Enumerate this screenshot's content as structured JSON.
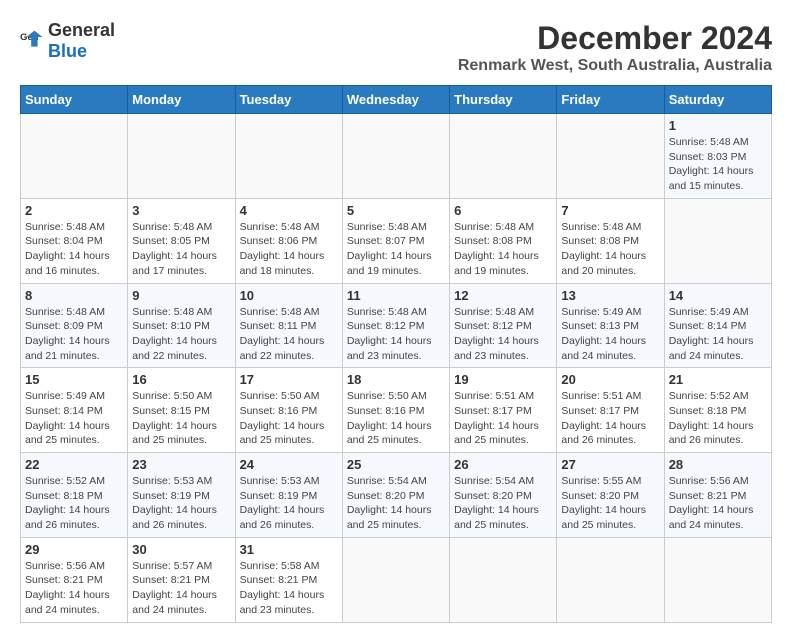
{
  "header": {
    "logo": {
      "general": "General",
      "blue": "Blue"
    },
    "title": "December 2024",
    "subtitle": "Renmark West, South Australia, Australia"
  },
  "calendar": {
    "days_of_week": [
      "Sunday",
      "Monday",
      "Tuesday",
      "Wednesday",
      "Thursday",
      "Friday",
      "Saturday"
    ],
    "weeks": [
      [
        {
          "day": "",
          "empty": true
        },
        {
          "day": "",
          "empty": true
        },
        {
          "day": "",
          "empty": true
        },
        {
          "day": "",
          "empty": true
        },
        {
          "day": "",
          "empty": true
        },
        {
          "day": "",
          "empty": true
        },
        {
          "day": "1",
          "sunrise": "Sunrise: 5:48 AM",
          "sunset": "Sunset: 8:03 PM",
          "daylight": "Daylight: 14 hours and 15 minutes."
        }
      ],
      [
        {
          "day": "2",
          "sunrise": "Sunrise: 5:48 AM",
          "sunset": "Sunset: 8:04 PM",
          "daylight": "Daylight: 14 hours and 16 minutes."
        },
        {
          "day": "3",
          "sunrise": "Sunrise: 5:48 AM",
          "sunset": "Sunset: 8:05 PM",
          "daylight": "Daylight: 14 hours and 17 minutes."
        },
        {
          "day": "4",
          "sunrise": "Sunrise: 5:48 AM",
          "sunset": "Sunset: 8:06 PM",
          "daylight": "Daylight: 14 hours and 18 minutes."
        },
        {
          "day": "5",
          "sunrise": "Sunrise: 5:48 AM",
          "sunset": "Sunset: 8:07 PM",
          "daylight": "Daylight: 14 hours and 19 minutes."
        },
        {
          "day": "6",
          "sunrise": "Sunrise: 5:48 AM",
          "sunset": "Sunset: 8:08 PM",
          "daylight": "Daylight: 14 hours and 19 minutes."
        },
        {
          "day": "7",
          "sunrise": "Sunrise: 5:48 AM",
          "sunset": "Sunset: 8:08 PM",
          "daylight": "Daylight: 14 hours and 20 minutes."
        }
      ],
      [
        {
          "day": "8",
          "sunrise": "Sunrise: 5:48 AM",
          "sunset": "Sunset: 8:09 PM",
          "daylight": "Daylight: 14 hours and 21 minutes."
        },
        {
          "day": "9",
          "sunrise": "Sunrise: 5:48 AM",
          "sunset": "Sunset: 8:10 PM",
          "daylight": "Daylight: 14 hours and 22 minutes."
        },
        {
          "day": "10",
          "sunrise": "Sunrise: 5:48 AM",
          "sunset": "Sunset: 8:11 PM",
          "daylight": "Daylight: 14 hours and 22 minutes."
        },
        {
          "day": "11",
          "sunrise": "Sunrise: 5:48 AM",
          "sunset": "Sunset: 8:12 PM",
          "daylight": "Daylight: 14 hours and 23 minutes."
        },
        {
          "day": "12",
          "sunrise": "Sunrise: 5:48 AM",
          "sunset": "Sunset: 8:12 PM",
          "daylight": "Daylight: 14 hours and 23 minutes."
        },
        {
          "day": "13",
          "sunrise": "Sunrise: 5:49 AM",
          "sunset": "Sunset: 8:13 PM",
          "daylight": "Daylight: 14 hours and 24 minutes."
        },
        {
          "day": "14",
          "sunrise": "Sunrise: 5:49 AM",
          "sunset": "Sunset: 8:14 PM",
          "daylight": "Daylight: 14 hours and 24 minutes."
        }
      ],
      [
        {
          "day": "15",
          "sunrise": "Sunrise: 5:49 AM",
          "sunset": "Sunset: 8:14 PM",
          "daylight": "Daylight: 14 hours and 25 minutes."
        },
        {
          "day": "16",
          "sunrise": "Sunrise: 5:50 AM",
          "sunset": "Sunset: 8:15 PM",
          "daylight": "Daylight: 14 hours and 25 minutes."
        },
        {
          "day": "17",
          "sunrise": "Sunrise: 5:50 AM",
          "sunset": "Sunset: 8:16 PM",
          "daylight": "Daylight: 14 hours and 25 minutes."
        },
        {
          "day": "18",
          "sunrise": "Sunrise: 5:50 AM",
          "sunset": "Sunset: 8:16 PM",
          "daylight": "Daylight: 14 hours and 25 minutes."
        },
        {
          "day": "19",
          "sunrise": "Sunrise: 5:51 AM",
          "sunset": "Sunset: 8:17 PM",
          "daylight": "Daylight: 14 hours and 25 minutes."
        },
        {
          "day": "20",
          "sunrise": "Sunrise: 5:51 AM",
          "sunset": "Sunset: 8:17 PM",
          "daylight": "Daylight: 14 hours and 26 minutes."
        },
        {
          "day": "21",
          "sunrise": "Sunrise: 5:52 AM",
          "sunset": "Sunset: 8:18 PM",
          "daylight": "Daylight: 14 hours and 26 minutes."
        }
      ],
      [
        {
          "day": "22",
          "sunrise": "Sunrise: 5:52 AM",
          "sunset": "Sunset: 8:18 PM",
          "daylight": "Daylight: 14 hours and 26 minutes."
        },
        {
          "day": "23",
          "sunrise": "Sunrise: 5:53 AM",
          "sunset": "Sunset: 8:19 PM",
          "daylight": "Daylight: 14 hours and 26 minutes."
        },
        {
          "day": "24",
          "sunrise": "Sunrise: 5:53 AM",
          "sunset": "Sunset: 8:19 PM",
          "daylight": "Daylight: 14 hours and 26 minutes."
        },
        {
          "day": "25",
          "sunrise": "Sunrise: 5:54 AM",
          "sunset": "Sunset: 8:20 PM",
          "daylight": "Daylight: 14 hours and 25 minutes."
        },
        {
          "day": "26",
          "sunrise": "Sunrise: 5:54 AM",
          "sunset": "Sunset: 8:20 PM",
          "daylight": "Daylight: 14 hours and 25 minutes."
        },
        {
          "day": "27",
          "sunrise": "Sunrise: 5:55 AM",
          "sunset": "Sunset: 8:20 PM",
          "daylight": "Daylight: 14 hours and 25 minutes."
        },
        {
          "day": "28",
          "sunrise": "Sunrise: 5:56 AM",
          "sunset": "Sunset: 8:21 PM",
          "daylight": "Daylight: 14 hours and 24 minutes."
        }
      ],
      [
        {
          "day": "29",
          "sunrise": "Sunrise: 5:56 AM",
          "sunset": "Sunset: 8:21 PM",
          "daylight": "Daylight: 14 hours and 24 minutes."
        },
        {
          "day": "30",
          "sunrise": "Sunrise: 5:57 AM",
          "sunset": "Sunset: 8:21 PM",
          "daylight": "Daylight: 14 hours and 24 minutes."
        },
        {
          "day": "31",
          "sunrise": "Sunrise: 5:58 AM",
          "sunset": "Sunset: 8:21 PM",
          "daylight": "Daylight: 14 hours and 23 minutes."
        },
        {
          "day": "",
          "empty": true
        },
        {
          "day": "",
          "empty": true
        },
        {
          "day": "",
          "empty": true
        },
        {
          "day": "",
          "empty": true
        }
      ]
    ]
  }
}
